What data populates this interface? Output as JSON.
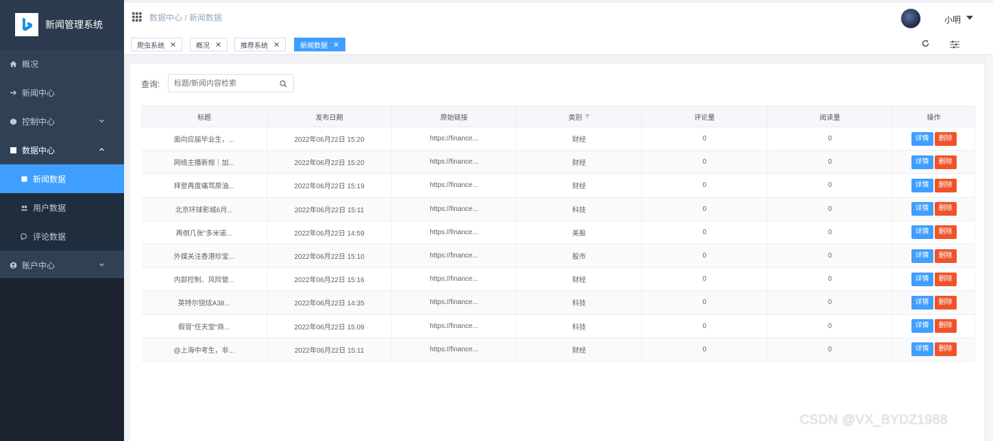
{
  "app": {
    "title": "新闻管理系统"
  },
  "sidebar": {
    "items": [
      {
        "label": "概况",
        "icon": "home-icon"
      },
      {
        "label": "新闻中心",
        "icon": "arrow-right-icon"
      },
      {
        "label": "控制中心",
        "icon": "cube-icon"
      },
      {
        "label": "数据中心",
        "icon": "table-icon"
      },
      {
        "label": "新闻数据",
        "icon": "document-icon"
      },
      {
        "label": "用户数据",
        "icon": "users-icon"
      },
      {
        "label": "评论数据",
        "icon": "comment-icon"
      },
      {
        "label": "账户中心",
        "icon": "user-circle-icon"
      }
    ]
  },
  "header": {
    "breadcrumb": "数据中心 / 新闻数据",
    "username": "小明"
  },
  "tags": [
    {
      "label": "爬虫系统"
    },
    {
      "label": "概况"
    },
    {
      "label": "推荐系统"
    },
    {
      "label": "新闻数据"
    }
  ],
  "search": {
    "label": "查询:",
    "placeholder": "标题/新闻内容检索"
  },
  "table": {
    "columns": [
      "标题",
      "发布日期",
      "原始链接",
      "类别",
      "评论量",
      "阅读量",
      "操作"
    ],
    "rows": [
      {
        "title": "面向应届毕业生，...",
        "date": "2022年06月22日 15:20",
        "link": "https://finance...",
        "category": "财经",
        "comments": "0",
        "reads": "0"
      },
      {
        "title": "网络主播新规｜加...",
        "date": "2022年06月22日 15:20",
        "link": "https://finance...",
        "category": "财经",
        "comments": "0",
        "reads": "0"
      },
      {
        "title": "拜登再度痛骂原油...",
        "date": "2022年06月22日 15:19",
        "link": "https://finance...",
        "category": "财经",
        "comments": "0",
        "reads": "0"
      },
      {
        "title": "北京环球影城6月...",
        "date": "2022年06月22日 15:11",
        "link": "https://finance...",
        "category": "科技",
        "comments": "0",
        "reads": "0"
      },
      {
        "title": "再倒几张\"多米诺...",
        "date": "2022年06月22日 14:59",
        "link": "https://finance...",
        "category": "美股",
        "comments": "0",
        "reads": "0"
      },
      {
        "title": "外媒关注香港珍宝...",
        "date": "2022年06月22日 15:10",
        "link": "https://finance...",
        "category": "股市",
        "comments": "0",
        "reads": "0"
      },
      {
        "title": "内部控制、风险管...",
        "date": "2022年06月22日 15:16",
        "link": "https://finance...",
        "category": "财经",
        "comments": "0",
        "reads": "0"
      },
      {
        "title": "英特尔锐炫A38...",
        "date": "2022年06月22日 14:35",
        "link": "https://finance...",
        "category": "科技",
        "comments": "0",
        "reads": "0"
      },
      {
        "title": "假冒\"任天堂\"商...",
        "date": "2022年06月22日 15:09",
        "link": "https://finance...",
        "category": "科技",
        "comments": "0",
        "reads": "0"
      },
      {
        "title": "@上海中考生，非...",
        "date": "2022年06月22日 15:11",
        "link": "https://finance...",
        "category": "财经",
        "comments": "0",
        "reads": "0"
      }
    ],
    "action_detail": "详情",
    "action_delete": "删除"
  },
  "watermark": "CSDN @VX_BYDZ1988",
  "colors": {
    "sidebar": "#304156",
    "accent": "#409eff",
    "danger": "#f0532a"
  }
}
